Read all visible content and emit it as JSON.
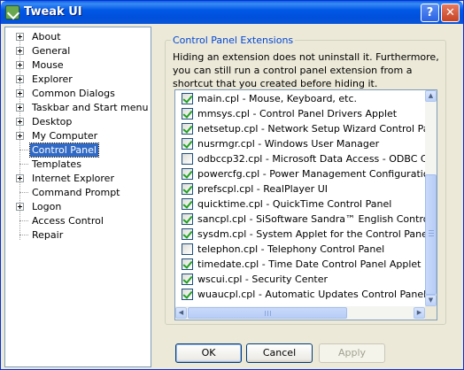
{
  "window": {
    "title": "Tweak UI",
    "help_glyph": "?",
    "close_glyph": "✕"
  },
  "tree": {
    "items": [
      {
        "label": "About",
        "expandable": true
      },
      {
        "label": "General",
        "expandable": true
      },
      {
        "label": "Mouse",
        "expandable": true
      },
      {
        "label": "Explorer",
        "expandable": true
      },
      {
        "label": "Common Dialogs",
        "expandable": true
      },
      {
        "label": "Taskbar and Start menu",
        "expandable": true
      },
      {
        "label": "Desktop",
        "expandable": true
      },
      {
        "label": "My Computer",
        "expandable": true
      },
      {
        "label": "Control Panel",
        "expandable": false,
        "selected": true
      },
      {
        "label": "Templates",
        "expandable": false
      },
      {
        "label": "Internet Explorer",
        "expandable": true
      },
      {
        "label": "Command Prompt",
        "expandable": false
      },
      {
        "label": "Logon",
        "expandable": true
      },
      {
        "label": "Access Control",
        "expandable": false
      },
      {
        "label": "Repair",
        "expandable": false
      }
    ]
  },
  "panel": {
    "group_title": "Control Panel Extensions",
    "description": "Hiding an extension does not uninstall it. Furthermore, you can still run a control panel extension from a shortcut that you created before hiding it.",
    "extensions": [
      {
        "label": "main.cpl - Mouse, Keyboard, etc.",
        "checked": true
      },
      {
        "label": "mmsys.cpl - Control Panel Drivers Applet",
        "checked": true
      },
      {
        "label": "netsetup.cpl - Network Setup Wizard Control Panel A",
        "checked": true
      },
      {
        "label": "nusrmgr.cpl - Windows User Manager",
        "checked": true
      },
      {
        "label": "odbccp32.cpl - Microsoft Data Access - ODBC Contro",
        "checked": false
      },
      {
        "label": "powercfg.cpl - Power Management Configuration Cor",
        "checked": true
      },
      {
        "label": "prefscpl.cpl - RealPlayer UI",
        "checked": true
      },
      {
        "label": "quicktime.cpl - QuickTime Control Panel",
        "checked": true
      },
      {
        "label": "sancpl.cpl - SiSoftware Sandra™ English Control Pane",
        "checked": true
      },
      {
        "label": "sysdm.cpl - System Applet for the Control Panel",
        "checked": true
      },
      {
        "label": "telephon.cpl - Telephony Control Panel",
        "checked": false
      },
      {
        "label": "timedate.cpl - Time Date Control Panel Applet",
        "checked": true
      },
      {
        "label": "wscui.cpl - Security Center",
        "checked": true
      },
      {
        "label": "wuaucpl.cpl - Automatic Updates Control Panel",
        "checked": true
      }
    ],
    "scroll_up": "▲",
    "scroll_down": "▼",
    "scroll_left": "◀",
    "scroll_right": "▶"
  },
  "buttons": {
    "ok": "OK",
    "cancel": "Cancel",
    "apply": "Apply"
  }
}
